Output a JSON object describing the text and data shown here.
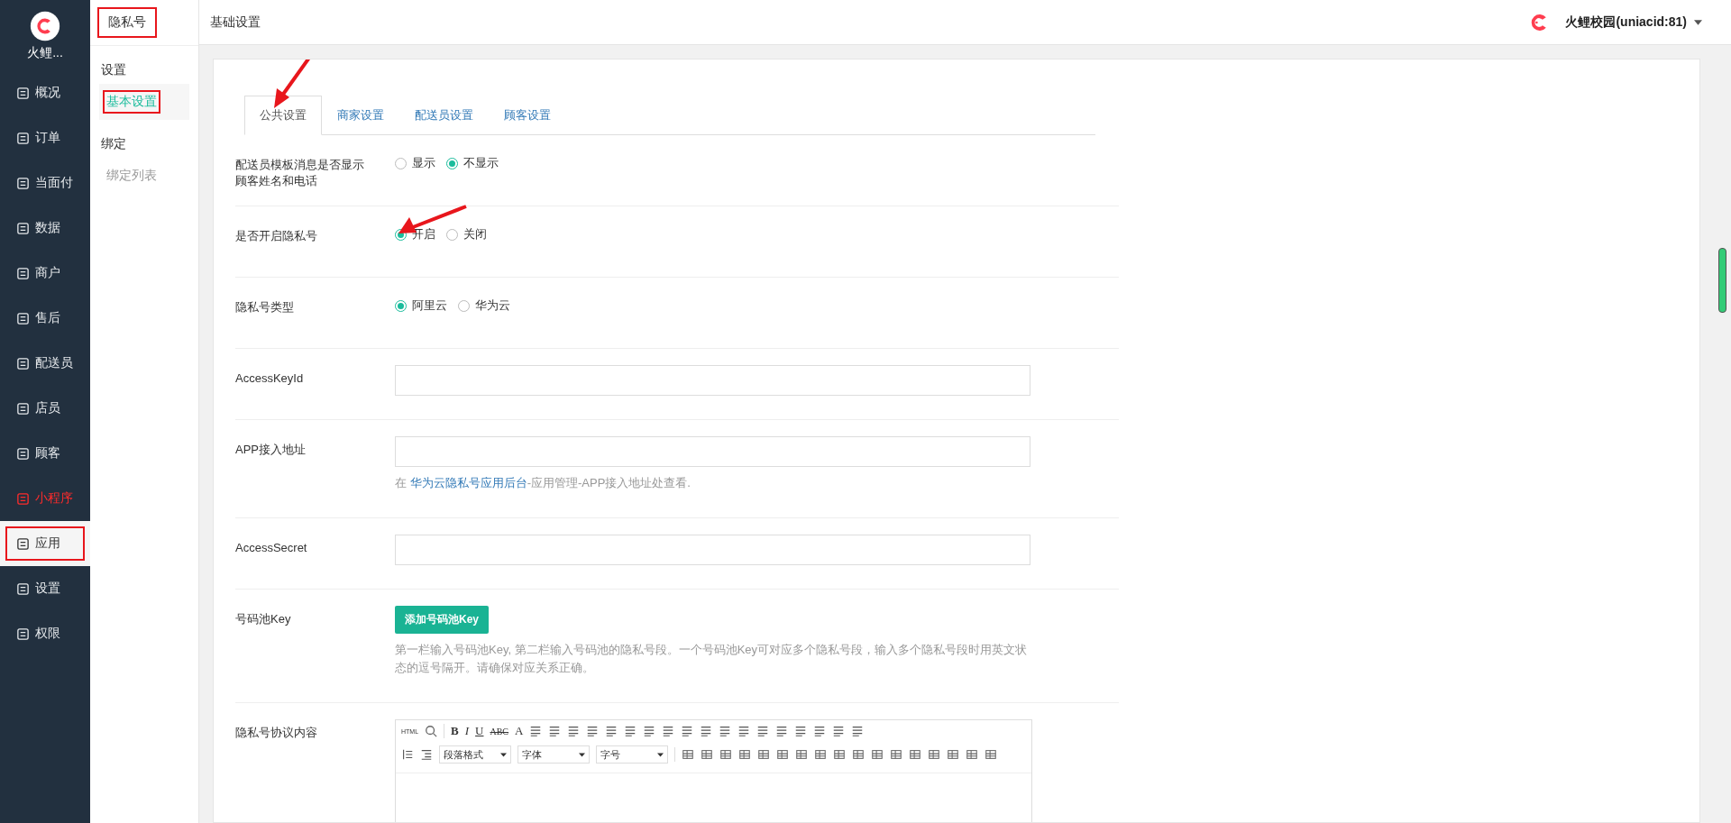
{
  "brand": {
    "name": "火鲤..."
  },
  "nav": [
    {
      "label": "概况",
      "selected": false,
      "color": "#e6e9ec",
      "annotated": false
    },
    {
      "label": "订单",
      "selected": false,
      "color": "#e6e9ec",
      "annotated": false
    },
    {
      "label": "当面付",
      "selected": false,
      "color": "#e6e9ec",
      "annotated": false
    },
    {
      "label": "数据",
      "selected": false,
      "color": "#e6e9ec",
      "annotated": false
    },
    {
      "label": "商户",
      "selected": false,
      "color": "#e6e9ec",
      "annotated": false
    },
    {
      "label": "售后",
      "selected": false,
      "color": "#e6e9ec",
      "annotated": false
    },
    {
      "label": "配送员",
      "selected": false,
      "color": "#e6e9ec",
      "annotated": false
    },
    {
      "label": "店员",
      "selected": false,
      "color": "#e6e9ec",
      "annotated": false
    },
    {
      "label": "顾客",
      "selected": false,
      "color": "#e6e9ec",
      "annotated": false
    },
    {
      "label": "小程序",
      "selected": false,
      "color": "#ff2b2b",
      "annotated": false
    },
    {
      "label": "应用",
      "selected": true,
      "color": "#333333",
      "annotated": true
    },
    {
      "label": "设置",
      "selected": false,
      "color": "#e6e9ec",
      "annotated": false
    },
    {
      "label": "权限",
      "selected": false,
      "color": "#e6e9ec",
      "annotated": false
    }
  ],
  "subnav": {
    "title": "隐私号",
    "title_annotated": true,
    "groups": [
      {
        "heading": "设置",
        "items": [
          {
            "label": "基本设置",
            "selected": true,
            "annotated": true
          }
        ]
      },
      {
        "heading": "绑定",
        "items": [
          {
            "label": "绑定列表",
            "selected": false,
            "annotated": false
          }
        ]
      }
    ]
  },
  "topbar": {
    "title": "基础设置",
    "account": "火鲤校园(uniacid:81)"
  },
  "tabs": [
    {
      "label": "公共设置",
      "selected": true,
      "arrow": true
    },
    {
      "label": "商家设置",
      "selected": false,
      "arrow": false
    },
    {
      "label": "配送员设置",
      "selected": false,
      "arrow": false
    },
    {
      "label": "顾客设置",
      "selected": false,
      "arrow": false
    }
  ],
  "rows": [
    {
      "kind": "radio",
      "label": "配送员模板消息是否显示顾客姓名和电话",
      "options": [
        {
          "label": "显示",
          "selected": false,
          "arrow": false
        },
        {
          "label": "不显示",
          "selected": true,
          "arrow": false
        }
      ]
    },
    {
      "kind": "radio",
      "label": "是否开启隐私号",
      "options": [
        {
          "label": "开启",
          "selected": true,
          "arrow": true
        },
        {
          "label": "关闭",
          "selected": false,
          "arrow": false
        }
      ]
    },
    {
      "kind": "radio",
      "label": "隐私号类型",
      "options": [
        {
          "label": "阿里云",
          "selected": true,
          "arrow": false
        },
        {
          "label": "华为云",
          "selected": false,
          "arrow": false
        }
      ]
    },
    {
      "kind": "input",
      "label": "AccessKeyId"
    },
    {
      "kind": "input",
      "label": "APP接入地址",
      "help": {
        "before": "在 ",
        "link": "华为云隐私号应用后台",
        "after": "-应用管理-APP接入地址处查看."
      }
    },
    {
      "kind": "input",
      "label": "AccessSecret"
    },
    {
      "kind": "button",
      "label": "号码池Key",
      "button": "添加号码池Key",
      "note": "第一栏输入号码池Key, 第二栏输入号码池的隐私号段。一个号码池Key可对应多个隐私号段，输入多个隐私号段时用英文状态的逗号隔开。请确保对应关系正确。"
    },
    {
      "kind": "editor",
      "label": "隐私号协议内容",
      "text_buttons": [
        "HTML",
        "B",
        "I",
        "U",
        "ABC",
        "A"
      ],
      "selects": [
        "段落格式",
        "字体",
        "字号"
      ]
    }
  ]
}
